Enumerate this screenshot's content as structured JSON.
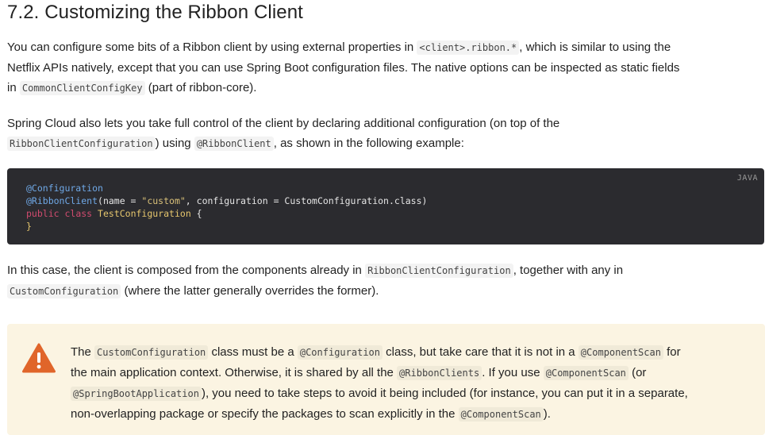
{
  "heading": "7.2. Customizing the Ribbon Client",
  "intro": {
    "p1_a": "You can configure some bits of a Ribbon client by using external properties in ",
    "p1_code1": "<client>.ribbon.*",
    "p1_b": ", which is similar to using the",
    "p1_c": "Netflix APIs natively, except that you can use Spring Boot configuration files. The native options can be inspected as static fields",
    "p1_d": "in ",
    "p1_code2": "CommonClientConfigKey",
    "p1_e": " (part of ribbon-core)."
  },
  "second": {
    "a": "Spring Cloud also lets you take full control of the client by declaring additional configuration (on top of the",
    "code1": "RibbonClientConfiguration",
    "b": ") using ",
    "code2": "@RibbonClient",
    "c": ", as shown in the following example:"
  },
  "code_block": {
    "language": "JAVA",
    "line1_ann": "@Configuration",
    "line2_ann": "@RibbonClient",
    "line2_a": "(name = ",
    "line2_str": "\"custom\"",
    "line2_b": ", configuration = CustomConfiguration.class)",
    "line3_kw1": "public",
    "line3_kw2": "class",
    "line3_cls": "TestConfiguration",
    "line3_end": " {",
    "line4": "}"
  },
  "third": {
    "a": "In this case, the client is composed from the components already in ",
    "code1": "RibbonClientConfiguration",
    "b": ", together with any in",
    "code2": "CustomConfiguration",
    "c": " (where the latter generally overrides the former)."
  },
  "warning": {
    "icon": "warning-triangle-icon",
    "l1_a": "The ",
    "l1_code1": "CustomConfiguration",
    "l1_b": " class must be a ",
    "l1_code2": "@Configuration",
    "l1_c": " class, but take care that it is not in a ",
    "l1_code3": "@ComponentScan",
    "l1_d": " for",
    "l2_a": "the main application context. Otherwise, it is shared by all the ",
    "l2_code1": "@RibbonClients",
    "l2_b": ". If you use ",
    "l2_code2": "@ComponentScan",
    "l2_c": " (or",
    "l3_code1": "@SpringBootApplication",
    "l3_a": "), you need to take steps to avoid it being included (for instance, you can put it in a separate,",
    "l4_a": "non-overlapping package or specify the packages to scan explicitly in the ",
    "l4_code1": "@ComponentScan",
    "l4_b": ")."
  },
  "colors": {
    "code_bg": "#2b2b2f",
    "warning_bg": "#fbf4e2",
    "warning_icon": "#e0652a"
  }
}
